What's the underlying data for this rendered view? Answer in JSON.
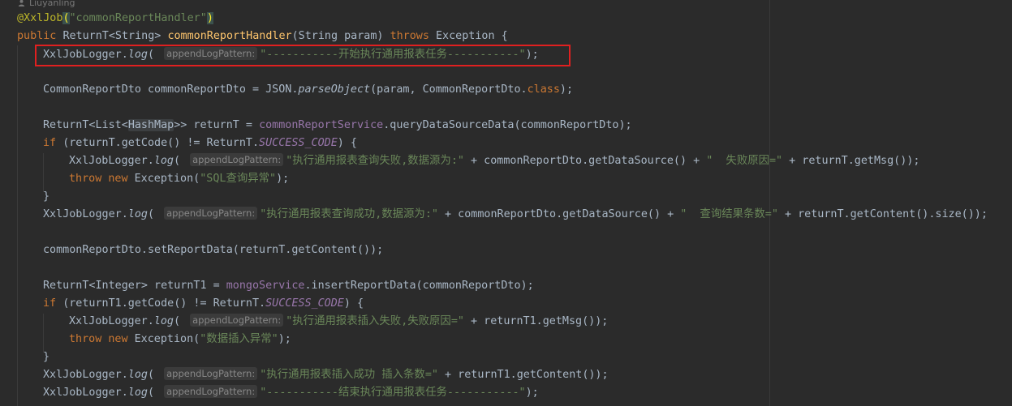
{
  "author": "Liuyanling",
  "colors": {
    "background": "#2b2b2b",
    "keyword": "#cc7832",
    "string": "#6a8759",
    "annotation": "#bbb529",
    "method_decl": "#ffc66d",
    "field": "#9876aa",
    "highlight_border": "#e02020"
  },
  "hint": "appendLogPattern:",
  "code": {
    "l1": {
      "ann": "@XxlJob",
      "p1": "(",
      "s": "\"commonReportHandler\"",
      "p2": ")"
    },
    "l2": {
      "kw1": "public ",
      "t1": "ReturnT<String> ",
      "fn": "commonReportHandler",
      "t2": "(String param) ",
      "kw2": "throws ",
      "t3": "Exception {"
    },
    "l3": {
      "t1": "XxlJobLogger.",
      "m": "log",
      "t2": "( ",
      "s": "\"-----------开始执行通用报表任务-----------\"",
      "t3": ");"
    },
    "l5": {
      "t1": "CommonReportDto commonReportDto = JSON.",
      "m": "parseObject",
      "t2": "(param, ",
      "t3": "CommonReportDto.",
      "kw": "class",
      "t4": ");"
    },
    "l7": {
      "t1": "ReturnT<List<",
      "hm": "HashMap",
      "t2": ">> returnT = ",
      "f": "commonReportService",
      "t3": ".queryDataSourceData(commonReportDto);"
    },
    "l8": {
      "kw": "if ",
      "t1": "(returnT.getCode() != ReturnT.",
      "c": "SUCCESS_CODE",
      "t2": ") {"
    },
    "l9": {
      "t1": "XxlJobLogger.",
      "m": "log",
      "t2": "( ",
      "s1": "\"执行通用报表查询失败,数据源为:\"",
      "t3": " + commonReportDto.getDataSource() + ",
      "s2": "\"  失败原因=\"",
      "t4": " + returnT.getMsg());"
    },
    "l10": {
      "kw1": "throw ",
      "kw2": "new ",
      "t1": "Exception(",
      "s": "\"SQL查询异常\"",
      "t2": ");"
    },
    "l11": {
      "t": "}"
    },
    "l12": {
      "t1": "XxlJobLogger.",
      "m": "log",
      "t2": "( ",
      "s1": "\"执行通用报表查询成功,数据源为:\"",
      "t3": " + commonReportDto.getDataSource() + ",
      "s2": "\"  查询结果条数=\"",
      "t4": " + returnT.getContent().size());"
    },
    "l14": {
      "t": "commonReportDto.setReportData(returnT.getContent());"
    },
    "l16": {
      "t1": "ReturnT<Integer> returnT1 = ",
      "f": "mongoService",
      "t2": ".insertReportData(commonReportDto);"
    },
    "l17": {
      "kw": "if ",
      "t1": "(returnT1.getCode() != ReturnT.",
      "c": "SUCCESS_CODE",
      "t2": ") {"
    },
    "l18": {
      "t1": "XxlJobLogger.",
      "m": "log",
      "t2": "( ",
      "s": "\"执行通用报表插入失败,失败原因=\"",
      "t3": " + returnT1.getMsg());"
    },
    "l19": {
      "kw1": "throw ",
      "kw2": "new ",
      "t1": "Exception(",
      "s": "\"数据插入异常\"",
      "t2": ");"
    },
    "l20": {
      "t": "}"
    },
    "l21": {
      "t1": "XxlJobLogger.",
      "m": "log",
      "t2": "( ",
      "s": "\"执行通用报表插入成功 插入条数=\"",
      "t3": " + returnT1.getContent());"
    },
    "l22": {
      "t1": "XxlJobLogger.",
      "m": "log",
      "t2": "( ",
      "s": "\"-----------结束执行通用报表任务-----------\"",
      "t3": ");"
    }
  }
}
